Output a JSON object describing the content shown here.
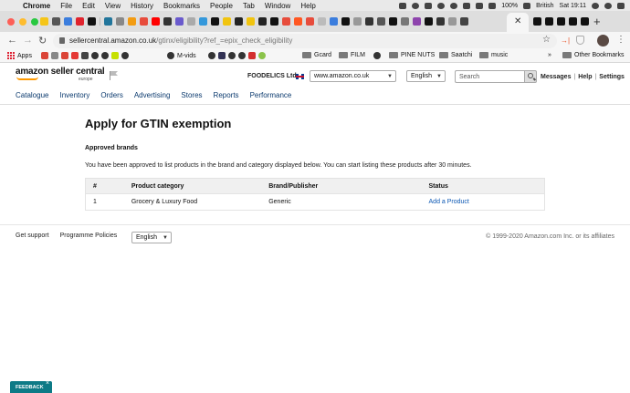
{
  "os_menubar": {
    "app": "Chrome",
    "items": [
      "File",
      "Edit",
      "View",
      "History",
      "Bookmarks",
      "People",
      "Tab",
      "Window",
      "Help"
    ],
    "battery": "100%",
    "input_source": "British",
    "clock": "Sat 19:11"
  },
  "browser": {
    "url_host": "sellercentral.amazon.co.uk",
    "url_path": "/gtinx/eligibility?ref_=epix_check_eligibility",
    "bookmarks": [
      {
        "label": "Apps",
        "icon": "apps-grid-icon"
      },
      {
        "label": "M-vids",
        "icon": "globe-icon"
      },
      {
        "label": "Gcard",
        "icon": "folder-icon"
      },
      {
        "label": "FILM",
        "icon": "folder-icon"
      },
      {
        "label": "PINE NUTS",
        "icon": "folder-icon"
      },
      {
        "label": "Saatchi",
        "icon": "folder-icon"
      },
      {
        "label": "music",
        "icon": "folder-icon"
      }
    ],
    "bookmarks_overflow": "»",
    "other_bookmarks": "Other Bookmarks"
  },
  "header": {
    "logo_text": "amazon seller central",
    "logo_sub": "europe",
    "seller_name": "FOODELICS Ltd",
    "marketplace": "www.amazon.co.uk",
    "language": "English",
    "search_placeholder": "Search",
    "links": [
      "Messages",
      "Help",
      "Settings"
    ]
  },
  "mainnav": [
    "Catalogue",
    "Inventory",
    "Orders",
    "Advertising",
    "Stores",
    "Reports",
    "Performance"
  ],
  "content": {
    "title": "Apply for GTIN exemption",
    "section_title": "Approved brands",
    "info": "You have been approved to list products in the brand and category displayed below. You can start listing these products after 30 minutes.",
    "table": {
      "headers": [
        "#",
        "Product category",
        "Brand/Publisher",
        "Status"
      ],
      "rows": [
        {
          "num": "1",
          "category": "Grocery & Luxury Food",
          "brand": "Generic",
          "action": "Add a Product"
        }
      ]
    }
  },
  "footer": {
    "get_support": "Get support",
    "policies": "Programme Policies",
    "language": "English",
    "copyright": "© 1999-2020 Amazon.com Inc. or its affiliates"
  },
  "feedback": {
    "label": "FEEDBACK",
    "close": "×"
  },
  "colors": {
    "nav_link": "#0b3a6e",
    "link": "#0b57b3",
    "feedback_bg": "#0d7a86",
    "logo_smile": "#ff9900"
  }
}
